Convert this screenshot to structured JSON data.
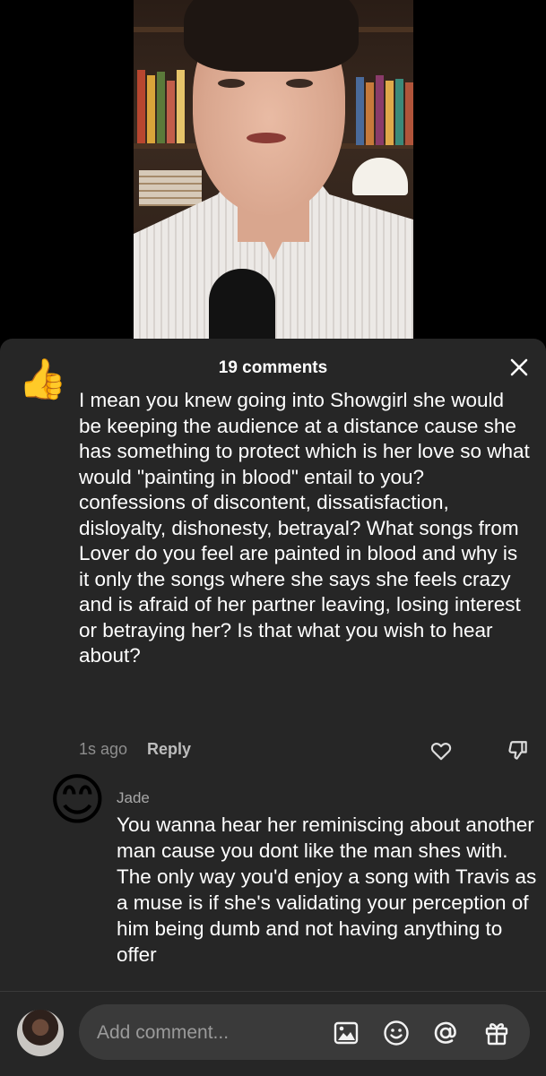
{
  "comments_header": {
    "count_label": "19 comments"
  },
  "main_comment": {
    "text": "I mean you knew going into Showgirl she would be keeping the audience at a distance cause she has something to protect which is her love so what would \"painting in blood\" entail to you? confessions of discontent, dissatisfaction, disloyalty, dishonesty, betrayal? What songs from Lover do you feel are painted in blood and why is it only the songs where she says she feels crazy and is afraid of her partner leaving, losing interest or betraying her? Is that what you wish to hear about?",
    "timestamp": "1s ago",
    "reply_label": "Reply"
  },
  "reply_comment": {
    "author": "Jade",
    "text": "You wanna hear her reminiscing about another man cause you dont like the man shes with. The only way you'd enjoy a song with Travis as a muse is if she's validating your perception of him being dumb and not having anything to offer"
  },
  "composer": {
    "placeholder": "Add comment..."
  },
  "icons": {
    "close": "close-icon",
    "like": "heart-outline-icon",
    "dislike": "thumbs-down-outline-icon",
    "image": "image-icon",
    "emoji": "smiley-icon",
    "mention": "at-sign-icon",
    "gift": "gift-icon"
  },
  "colors": {
    "sheet_bg": "#262626",
    "text": "#ffffff",
    "muted": "#8e8e8e",
    "input_bg": "#3a3a3a"
  }
}
